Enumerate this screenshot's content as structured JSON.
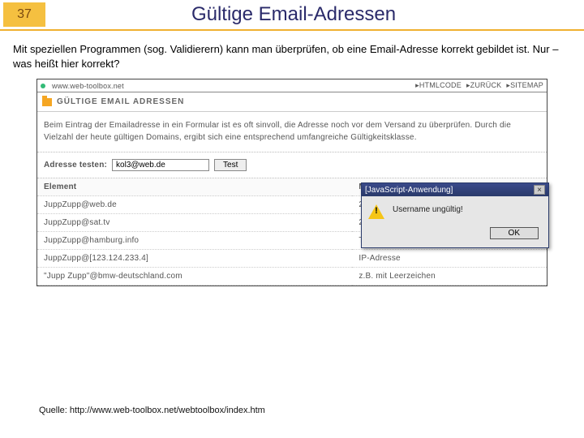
{
  "slide": {
    "number": "37",
    "title": "Gültige Email-Adressen",
    "intro": "Mit speziellen Programmen (sog. Validierern) kann man überprüfen, ob eine Email-Adresse korrekt gebildet ist. Nur – was heißt hier korrekt?",
    "source_label": "Quelle: ",
    "source_url": "http://www.web-toolbox.net/webtoolbox/index.htm"
  },
  "browser": {
    "url": "www.web-toolbox.net",
    "nav": {
      "htmlcode": "HTMLCODE",
      "back": "ZURÜCK",
      "sitemap": "SITEMAP"
    },
    "breadcrumb": "GÜLTIGE EMAIL ADRESSEN",
    "intro": "Beim Eintrag der Emailadresse in ein Formular ist es oft sinvoll, die Adresse noch vor dem Versand zu überprüfen. Durch die Vielzahl der heute gültigen Domains, ergibt sich eine entsprechend umfangreiche Gültigkeitsklasse.",
    "test": {
      "label": "Adresse testen:",
      "value": "kol3@web.de",
      "button": "Test"
    },
    "table": {
      "headers": {
        "col1": "Element",
        "col2": "Merkmal"
      },
      "rows": [
        {
          "c1": "JuppZupp@web.de",
          "c2": "2 Zeichen Domain"
        },
        {
          "c1": "JuppZupp@sat.tv",
          "c2": "2 Zeichen Topdomain"
        },
        {
          "c1": "JuppZupp@hamburg.info",
          "c2": "Top Level Domain"
        },
        {
          "c1": "JuppZupp@[123.124.233.4]",
          "c2": "IP-Adresse"
        },
        {
          "c1": "\"Jupp Zupp\"@bmw-deutschland.com",
          "c2": "z.B. mit Leerzeichen"
        }
      ]
    }
  },
  "dialog": {
    "title": "[JavaScript-Anwendung]",
    "message": "Username ungültig!",
    "ok": "OK",
    "close": "×"
  }
}
